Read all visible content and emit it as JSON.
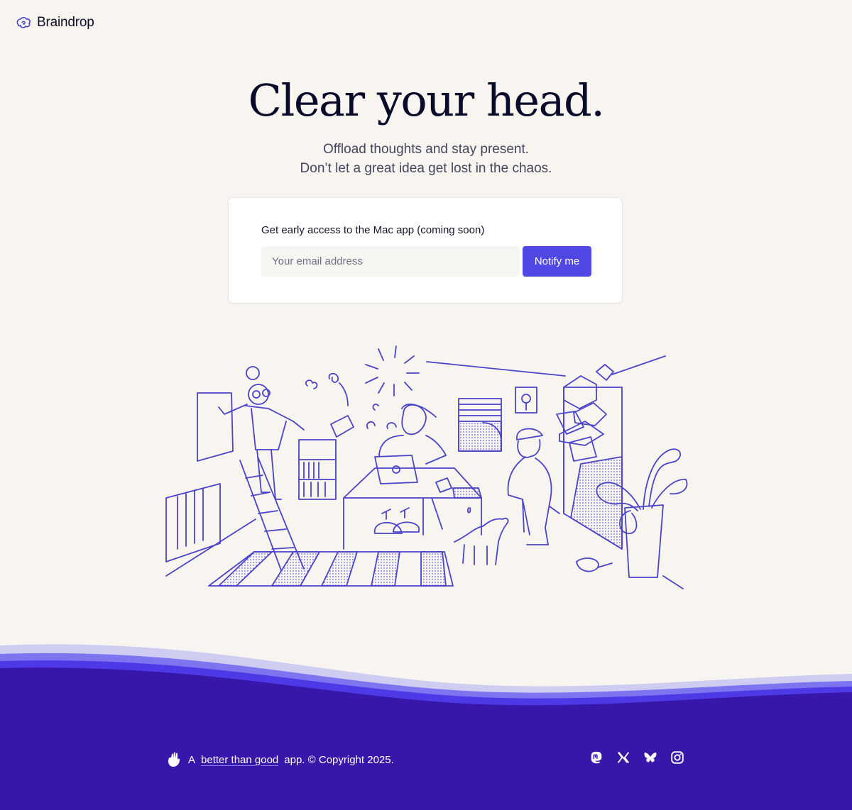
{
  "brand": {
    "name": "Braindrop",
    "logo_icon": "brain-swirl-icon"
  },
  "hero": {
    "title": "Clear your head.",
    "subtitle_line1": "Offload thoughts and stay present.",
    "subtitle_line2": "Don’t let a great idea get lost in the chaos."
  },
  "signup": {
    "label": "Get early access to the Mac app (coming soon)",
    "email_placeholder": "Your email address",
    "email_value": "",
    "button_label": "Notify me"
  },
  "footer": {
    "prefix": "A",
    "link_text": "better than good",
    "suffix": "app. © Copyright 2025.",
    "social_icons": [
      "mastodon-icon",
      "x-icon",
      "bluesky-icon",
      "instagram-icon"
    ]
  },
  "colors": {
    "background": "#f8f5f1",
    "accent": "#5048e5",
    "footer": "#3716aa",
    "illustration_stroke": "#4a44c9"
  }
}
